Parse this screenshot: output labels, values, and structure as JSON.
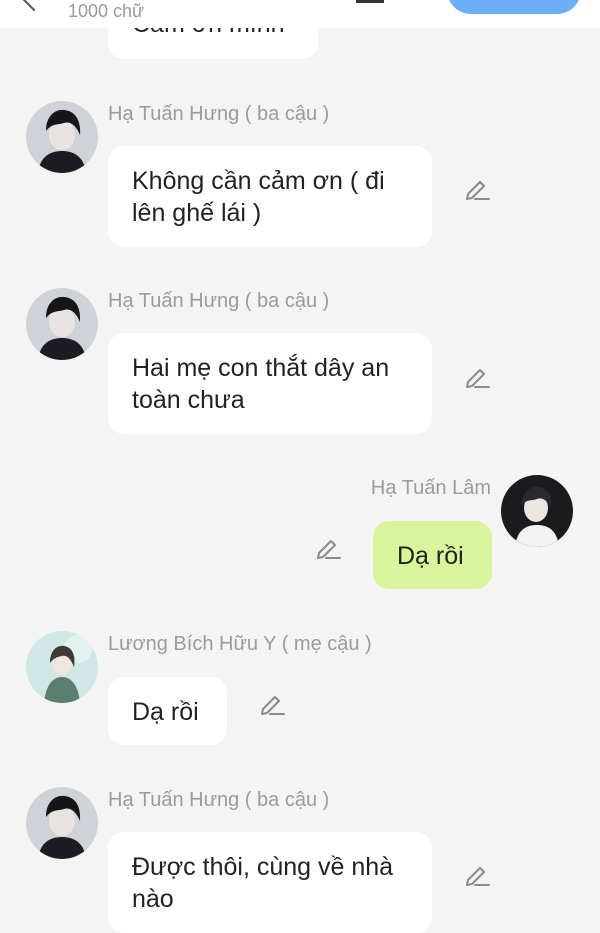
{
  "header": {
    "char_counter": "1000 chữ"
  },
  "messages": [
    {
      "id": "m0",
      "sender": "",
      "text": "Cảm ơn mình",
      "side": "left"
    },
    {
      "id": "m1",
      "sender": "Hạ Tuấn Hưng ( ba cậu )",
      "text": "Không cần cảm ơn ( đi lên ghế lái )",
      "side": "left"
    },
    {
      "id": "m2",
      "sender": "Hạ Tuấn Hưng ( ba cậu )",
      "text": "Hai mẹ con thắt dây an toàn chưa",
      "side": "left"
    },
    {
      "id": "m3",
      "sender": "Hạ Tuấn Lâm",
      "text": "Dạ rồi",
      "side": "right"
    },
    {
      "id": "m4",
      "sender": "Lương Bích Hữu Y ( mẹ cậu )",
      "text": "Dạ rồi",
      "side": "left"
    },
    {
      "id": "m5",
      "sender": "Hạ Tuấn Hưng ( ba cậu )",
      "text": "Được thôi, cùng về nhà nào",
      "side": "left"
    }
  ],
  "colors": {
    "background": "#f4f4f4",
    "bubble_other": "#ffffff",
    "bubble_mine": "#d9f59b",
    "name_text": "#9b9b9b",
    "accent_button": "#6aaef5"
  },
  "icons": {
    "edit": "pencil-edit-icon"
  }
}
